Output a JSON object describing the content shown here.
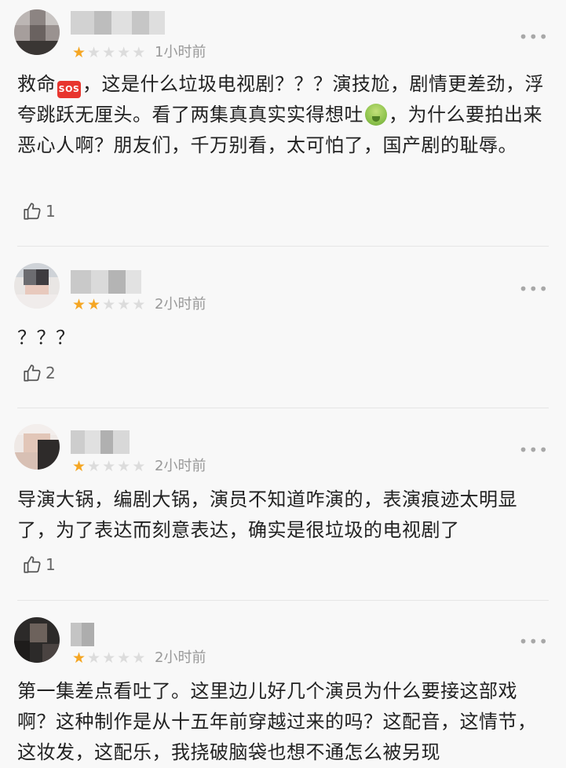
{
  "more_glyph": "•••",
  "reviews": [
    {
      "stars": 1,
      "time": "1小时前",
      "content_a": "救命",
      "sos": "SOS",
      "content_b": "，这是什么垃圾电视剧？？？演技尬，剧情更差劲，浮夸跳跃无厘头。看了两集真真实实得想吐",
      "content_c": "，为什么要拍出来恶心人啊？朋友们，千万别看，太可怕了，国产剧的耻辱。",
      "likes": "1"
    },
    {
      "stars": 2,
      "time": "2小时前",
      "content": "？？？",
      "likes": "2"
    },
    {
      "stars": 1,
      "time": "2小时前",
      "content": "导演大锅，编剧大锅，演员不知道咋演的，表演痕迹太明显了，为了表达而刻意表达，确实是很垃圾的电视剧了",
      "likes": "1"
    },
    {
      "stars": 1,
      "time": "2小时前",
      "content": "第一集差点看吐了。这里边儿好几个演员为什么要接这部戏啊？这种制作是从十五年前穿越过来的吗？这配音，这情节，这妆发，这配乐，我挠破脑袋也想不通怎么被另现"
    }
  ],
  "icons": {
    "like": "thumb-up-icon",
    "more": "more-dots-icon",
    "star": "star-icon"
  },
  "colors": {
    "star_on": "#f5a623",
    "star_off": "#dcdcdc",
    "text": "#222222",
    "meta": "#999999",
    "bg": "#f8f8f8"
  }
}
